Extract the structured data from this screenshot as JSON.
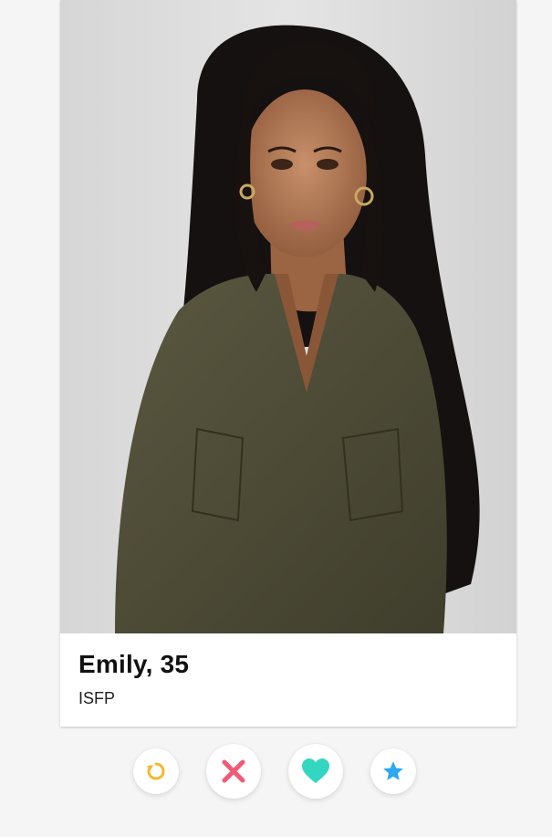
{
  "profile": {
    "name_age": "Emily, 35",
    "personality_type": "ISFP",
    "photo": {
      "description_icon": "portrait-photo"
    }
  },
  "actions": [
    {
      "name": "rewind-button",
      "icon": "rewind-icon",
      "color": "#F5B82E"
    },
    {
      "name": "dislike-button",
      "icon": "close-icon",
      "color": "#F25A74"
    },
    {
      "name": "like-button",
      "icon": "heart-icon",
      "color": "#33D6C1"
    },
    {
      "name": "super-like-button",
      "icon": "star-icon",
      "color": "#2EA8F0"
    }
  ],
  "colors": {
    "background": "#F5F5F5",
    "card": "#FFFFFF",
    "text_primary": "#111111"
  }
}
